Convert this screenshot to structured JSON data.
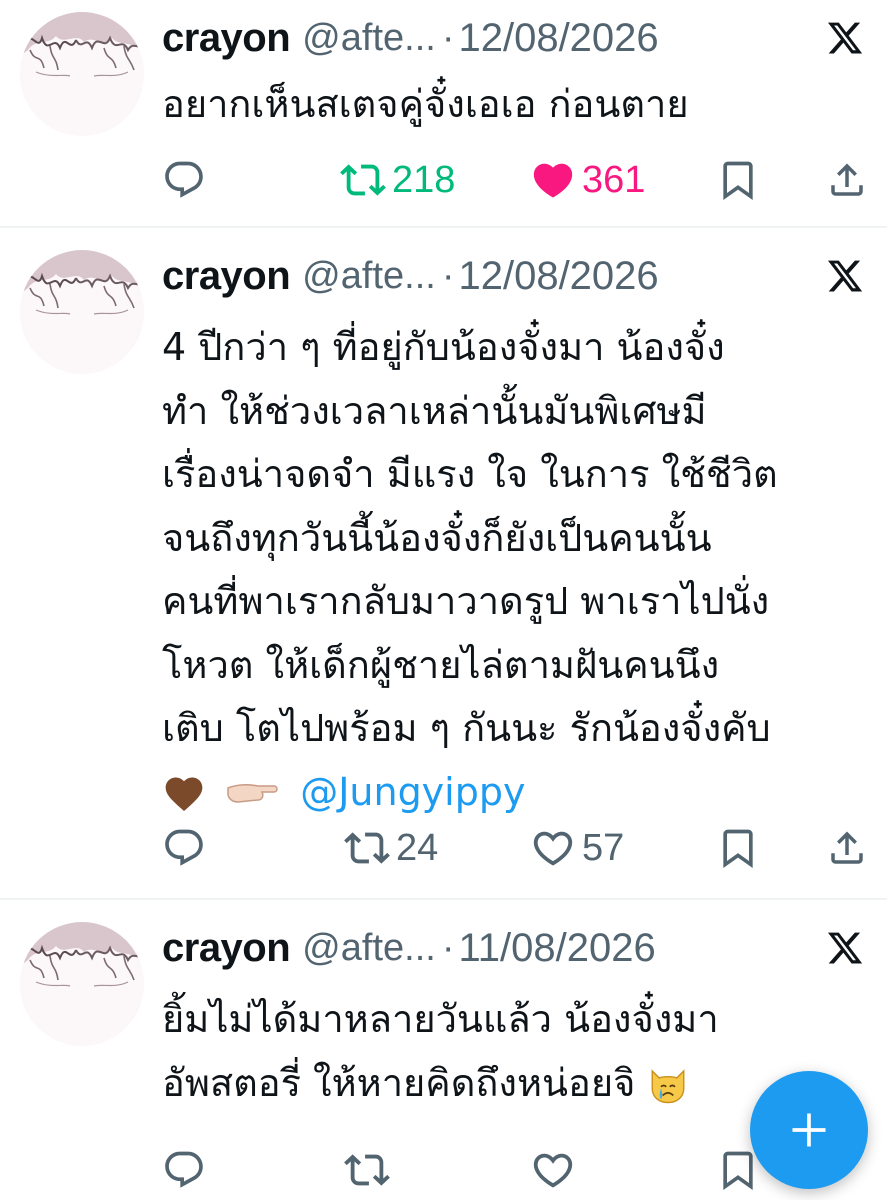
{
  "tweets": [
    {
      "name": "crayon",
      "handle": "@afte...",
      "dot": "·",
      "date": "12/08/2026",
      "lines": [
        "อยากเห็นสเตจคู่จั๋งเอเอ ก่อนตาย"
      ],
      "reposts": "218",
      "likes": "361",
      "reposted": true,
      "liked": true
    },
    {
      "name": "crayon",
      "handle": "@afte...",
      "dot": "·",
      "date": "12/08/2026",
      "lines": [
        "4 ปีกว่า ๆ ที่อยู่กับน้องจั๋งมา น้องจั๋ง",
        "ทำ ให้ช่วงเวลาเหล่านั้นมันพิเศษมี",
        "เรื่องน่าจดจำ มีแรง ใจ ในการ ใช้ชีวิต",
        "จนถึงทุกวันนี้น้องจั๋งก็ยังเป็นคนนั้น",
        "คนที่พาเรากลับมาวาดรูป พาเราไปนั่ง",
        "โหวต ให้เด็กผู้ชายไล่ตามฝันคนนึง",
        "เติบ โตไปพร้อม ๆ กันนะ รักน้องจั๋งคับ"
      ],
      "mention": "@Jungyippy",
      "reposts": "24",
      "likes": "57",
      "reposted": false,
      "liked": false
    },
    {
      "name": "crayon",
      "handle": "@afte...",
      "dot": "·",
      "date": "11/08/2026",
      "lines": [
        "ยิ้มไม่ได้มาหลายวันแล้ว น้องจั๋งมา",
        "อัพสตอรี่ ให้หายคิดถึงหน่อยจิ"
      ],
      "reposts": "",
      "likes": "",
      "reposted": false,
      "liked": false
    }
  ],
  "colors": {
    "repost_active": "#00ba7c",
    "like_active": "#f91880",
    "icon_gray": "#536471",
    "mention": "#1d9bf0",
    "fab": "#1d9bf0"
  },
  "icons": {
    "reply": "reply-icon",
    "repost": "repost-icon",
    "like": "heart-icon",
    "bookmark": "bookmark-icon",
    "share": "share-icon",
    "source": "x-logo-icon",
    "compose": "plus-icon"
  }
}
